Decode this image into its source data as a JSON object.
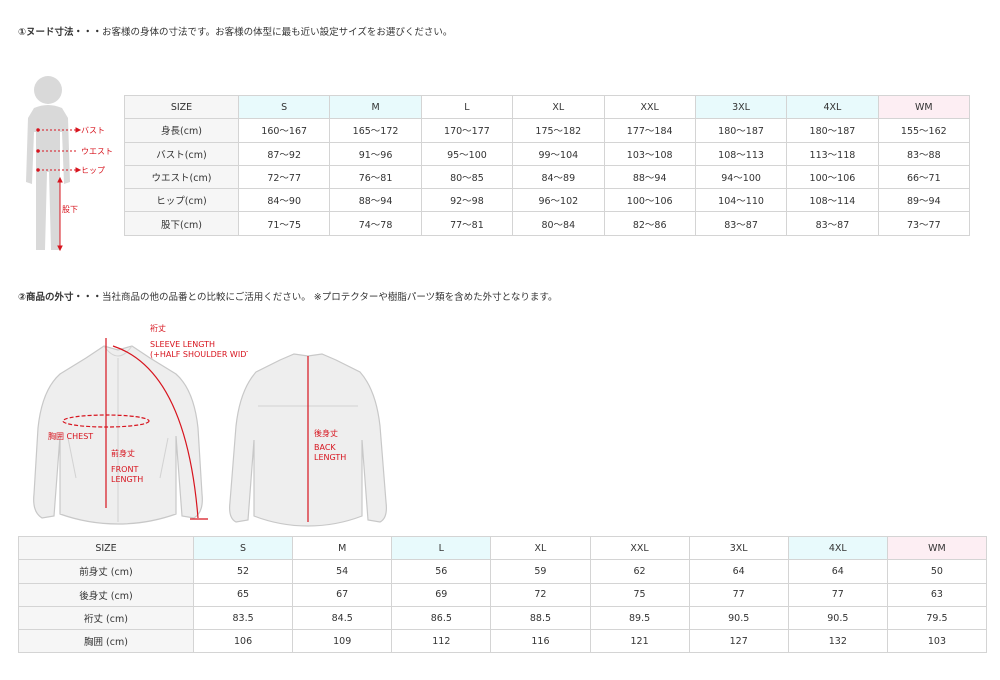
{
  "section1": {
    "heading_bold": "①ヌード寸法・・・",
    "heading_text": "お客様の身体の寸法です。お客様の体型に最も近い設定サイズをお選びください。",
    "figure_labels": {
      "bust": "バスト",
      "waist": "ウエスト",
      "hip": "ヒップ",
      "inseam": "股下"
    },
    "table": {
      "corner": "SIZE",
      "headers": [
        "S",
        "M",
        "L",
        "XL",
        "XXL",
        "3XL",
        "4XL",
        "WM"
      ],
      "header_colors": [
        "cyan",
        "cyan",
        "white",
        "white",
        "white",
        "cyan",
        "cyan",
        "pink"
      ],
      "rows": [
        {
          "label": "身長(cm)",
          "values": [
            "160〜167",
            "165〜172",
            "170〜177",
            "175〜182",
            "177〜184",
            "180〜187",
            "180〜187",
            "155〜162"
          ]
        },
        {
          "label": "バスト(cm)",
          "values": [
            "87〜92",
            "91〜96",
            "95〜100",
            "99〜104",
            "103〜108",
            "108〜113",
            "113〜118",
            "83〜88"
          ]
        },
        {
          "label": "ウエスト(cm)",
          "values": [
            "72〜77",
            "76〜81",
            "80〜85",
            "84〜89",
            "88〜94",
            "94〜100",
            "100〜106",
            "66〜71"
          ]
        },
        {
          "label": "ヒップ(cm)",
          "values": [
            "84〜90",
            "88〜94",
            "92〜98",
            "96〜102",
            "100〜106",
            "104〜110",
            "108〜114",
            "89〜94"
          ]
        },
        {
          "label": "股下(cm)",
          "values": [
            "71〜75",
            "74〜78",
            "77〜81",
            "80〜84",
            "82〜86",
            "83〜87",
            "83〜87",
            "73〜77"
          ]
        }
      ]
    }
  },
  "section2": {
    "heading_bold": "②商品の外寸・・・",
    "heading_text": "当社商品の他の品番との比較にご活用ください。 ※プロテクターや樹脂パーツ類を含めた外寸となります。",
    "figure_labels": {
      "sleeve_jp": "裄丈",
      "sleeve_en1": "SLEEVE LENGTH",
      "sleeve_en2": "(+HALF SHOULDER WIDTH)",
      "chest": "胸囲 CHEST",
      "front_jp": "前身丈",
      "front_en1": "FRONT",
      "front_en2": "LENGTH",
      "back_jp": "後身丈",
      "back_en1": "BACK",
      "back_en2": "LENGTH"
    },
    "table": {
      "corner": "SIZE",
      "headers": [
        "S",
        "M",
        "L",
        "XL",
        "XXL",
        "3XL",
        "4XL",
        "WM"
      ],
      "header_colors": [
        "cyan",
        "white",
        "cyan",
        "white",
        "white",
        "white",
        "cyan",
        "pink"
      ],
      "rows": [
        {
          "label": "前身丈 (cm)",
          "values": [
            "52",
            "54",
            "56",
            "59",
            "62",
            "64",
            "64",
            "50"
          ]
        },
        {
          "label": "後身丈 (cm)",
          "values": [
            "65",
            "67",
            "69",
            "72",
            "75",
            "77",
            "77",
            "63"
          ]
        },
        {
          "label": "裄丈 (cm)",
          "values": [
            "83.5",
            "84.5",
            "86.5",
            "88.5",
            "89.5",
            "90.5",
            "90.5",
            "79.5"
          ]
        },
        {
          "label": "胸囲 (cm)",
          "values": [
            "106",
            "109",
            "112",
            "116",
            "121",
            "127",
            "132",
            "103"
          ]
        }
      ]
    }
  },
  "colors": {
    "accent_red": "#d7141e",
    "silhouette": "#d9d9d9",
    "cyan": "#e8fafc",
    "pink": "#fdeef3"
  }
}
